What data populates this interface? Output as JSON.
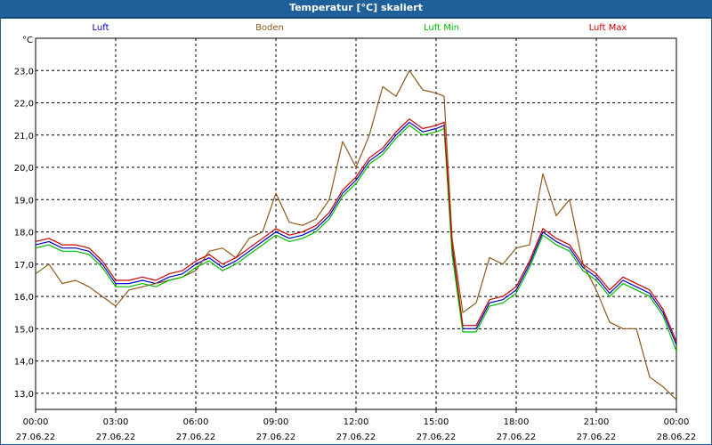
{
  "window": {
    "title": "Temperatur [°C] skaliert"
  },
  "chart_data": {
    "type": "line",
    "title": "Temperatur [°C] skaliert",
    "ylabel": "°C",
    "xlabel": "",
    "ylim": [
      12.5,
      24.0
    ],
    "xlim": [
      0,
      24
    ],
    "grid": true,
    "legend_placement": "top",
    "x_ticks": [
      {
        "t": 0,
        "time": "00:00",
        "date": "27.06.22"
      },
      {
        "t": 3,
        "time": "03:00",
        "date": "27.06.22"
      },
      {
        "t": 6,
        "time": "06:00",
        "date": "27.06.22"
      },
      {
        "t": 9,
        "time": "09:00",
        "date": "27.06.22"
      },
      {
        "t": 12,
        "time": "12:00",
        "date": "27.06.22"
      },
      {
        "t": 15,
        "time": "15:00",
        "date": "27.06.22"
      },
      {
        "t": 18,
        "time": "18:00",
        "date": "27.06.22"
      },
      {
        "t": 21,
        "time": "21:00",
        "date": "27.06.22"
      },
      {
        "t": 24,
        "time": "00:00",
        "date": "28.06.22"
      }
    ],
    "y_ticks": [
      {
        "v": 13.0,
        "label": "13,0"
      },
      {
        "v": 14.0,
        "label": "14,0"
      },
      {
        "v": 15.0,
        "label": "15,0"
      },
      {
        "v": 16.0,
        "label": "16,0"
      },
      {
        "v": 17.0,
        "label": "17,0"
      },
      {
        "v": 18.0,
        "label": "18,0"
      },
      {
        "v": 19.0,
        "label": "19,0"
      },
      {
        "v": 20.0,
        "label": "20,0"
      },
      {
        "v": 21.0,
        "label": "21,0"
      },
      {
        "v": 22.0,
        "label": "22,0"
      },
      {
        "v": 23.0,
        "label": "23,0"
      }
    ],
    "series": [
      {
        "name": "Luft",
        "color": "#0000c0",
        "points": [
          [
            0,
            17.6
          ],
          [
            0.5,
            17.7
          ],
          [
            1,
            17.5
          ],
          [
            1.5,
            17.5
          ],
          [
            2,
            17.4
          ],
          [
            2.5,
            17.0
          ],
          [
            3,
            16.4
          ],
          [
            3.5,
            16.4
          ],
          [
            4,
            16.5
          ],
          [
            4.5,
            16.4
          ],
          [
            5,
            16.6
          ],
          [
            5.5,
            16.7
          ],
          [
            6,
            17.0
          ],
          [
            6.5,
            17.2
          ],
          [
            7,
            16.9
          ],
          [
            7.5,
            17.1
          ],
          [
            8,
            17.4
          ],
          [
            8.5,
            17.7
          ],
          [
            9,
            18.0
          ],
          [
            9.5,
            17.8
          ],
          [
            10,
            17.9
          ],
          [
            10.5,
            18.1
          ],
          [
            11,
            18.5
          ],
          [
            11.5,
            19.2
          ],
          [
            12,
            19.6
          ],
          [
            12.5,
            20.2
          ],
          [
            13,
            20.5
          ],
          [
            13.5,
            21.0
          ],
          [
            14,
            21.4
          ],
          [
            14.5,
            21.1
          ],
          [
            15,
            21.2
          ],
          [
            15.3,
            21.3
          ],
          [
            15.6,
            17.5
          ],
          [
            16,
            15.0
          ],
          [
            16.5,
            15.0
          ],
          [
            17,
            15.8
          ],
          [
            17.5,
            15.9
          ],
          [
            18,
            16.2
          ],
          [
            18.5,
            17.0
          ],
          [
            19,
            18.0
          ],
          [
            19.5,
            17.7
          ],
          [
            20,
            17.5
          ],
          [
            20.5,
            16.9
          ],
          [
            21,
            16.6
          ],
          [
            21.5,
            16.1
          ],
          [
            22,
            16.5
          ],
          [
            22.5,
            16.3
          ],
          [
            23,
            16.1
          ],
          [
            23.5,
            15.5
          ],
          [
            24,
            14.5
          ]
        ]
      },
      {
        "name": "Boden",
        "color": "#8b5a1a",
        "points": [
          [
            0,
            16.7
          ],
          [
            0.5,
            17.0
          ],
          [
            1,
            16.4
          ],
          [
            1.5,
            16.5
          ],
          [
            2,
            16.3
          ],
          [
            2.5,
            16.0
          ],
          [
            3,
            15.7
          ],
          [
            3.5,
            16.2
          ],
          [
            4,
            16.3
          ],
          [
            4.5,
            16.4
          ],
          [
            5,
            16.5
          ],
          [
            5.5,
            16.6
          ],
          [
            6,
            16.8
          ],
          [
            6.5,
            17.4
          ],
          [
            7,
            17.5
          ],
          [
            7.5,
            17.2
          ],
          [
            8,
            17.8
          ],
          [
            8.5,
            18.0
          ],
          [
            9,
            19.2
          ],
          [
            9.5,
            18.3
          ],
          [
            10,
            18.2
          ],
          [
            10.5,
            18.4
          ],
          [
            11,
            19.0
          ],
          [
            11.5,
            20.8
          ],
          [
            12,
            20.0
          ],
          [
            12.5,
            21.0
          ],
          [
            13,
            22.5
          ],
          [
            13.5,
            22.2
          ],
          [
            14,
            23.0
          ],
          [
            14.5,
            22.4
          ],
          [
            15,
            22.3
          ],
          [
            15.3,
            22.2
          ],
          [
            15.6,
            17.8
          ],
          [
            16,
            15.5
          ],
          [
            16.5,
            15.8
          ],
          [
            17,
            17.2
          ],
          [
            17.5,
            17.0
          ],
          [
            18,
            17.5
          ],
          [
            18.5,
            17.6
          ],
          [
            19,
            19.8
          ],
          [
            19.5,
            18.5
          ],
          [
            20,
            19.0
          ],
          [
            20.5,
            17.0
          ],
          [
            21,
            16.2
          ],
          [
            21.5,
            15.2
          ],
          [
            22,
            15.0
          ],
          [
            22.5,
            15.0
          ],
          [
            23,
            13.5
          ],
          [
            23.5,
            13.2
          ],
          [
            24,
            12.8
          ]
        ]
      },
      {
        "name": "Luft Min",
        "color": "#00bb00",
        "points": [
          [
            0,
            17.5
          ],
          [
            0.5,
            17.6
          ],
          [
            1,
            17.4
          ],
          [
            1.5,
            17.4
          ],
          [
            2,
            17.3
          ],
          [
            2.5,
            16.9
          ],
          [
            3,
            16.3
          ],
          [
            3.5,
            16.3
          ],
          [
            4,
            16.4
          ],
          [
            4.5,
            16.3
          ],
          [
            5,
            16.5
          ],
          [
            5.5,
            16.6
          ],
          [
            6,
            16.9
          ],
          [
            6.5,
            17.1
          ],
          [
            7,
            16.8
          ],
          [
            7.5,
            17.0
          ],
          [
            8,
            17.3
          ],
          [
            8.5,
            17.6
          ],
          [
            9,
            17.9
          ],
          [
            9.5,
            17.7
          ],
          [
            10,
            17.8
          ],
          [
            10.5,
            18.0
          ],
          [
            11,
            18.4
          ],
          [
            11.5,
            19.1
          ],
          [
            12,
            19.5
          ],
          [
            12.5,
            20.1
          ],
          [
            13,
            20.4
          ],
          [
            13.5,
            20.9
          ],
          [
            14,
            21.3
          ],
          [
            14.5,
            21.0
          ],
          [
            15,
            21.1
          ],
          [
            15.3,
            21.2
          ],
          [
            15.6,
            17.3
          ],
          [
            16,
            14.9
          ],
          [
            16.5,
            14.9
          ],
          [
            17,
            15.7
          ],
          [
            17.5,
            15.8
          ],
          [
            18,
            16.1
          ],
          [
            18.5,
            16.9
          ],
          [
            19,
            17.9
          ],
          [
            19.5,
            17.6
          ],
          [
            20,
            17.4
          ],
          [
            20.5,
            16.8
          ],
          [
            21,
            16.5
          ],
          [
            21.5,
            16.0
          ],
          [
            22,
            16.4
          ],
          [
            22.5,
            16.2
          ],
          [
            23,
            16.0
          ],
          [
            23.5,
            15.4
          ],
          [
            24,
            14.3
          ]
        ]
      },
      {
        "name": "Luft Max",
        "color": "#cc0000",
        "points": [
          [
            0,
            17.7
          ],
          [
            0.5,
            17.8
          ],
          [
            1,
            17.6
          ],
          [
            1.5,
            17.6
          ],
          [
            2,
            17.5
          ],
          [
            2.5,
            17.1
          ],
          [
            3,
            16.5
          ],
          [
            3.5,
            16.5
          ],
          [
            4,
            16.6
          ],
          [
            4.5,
            16.5
          ],
          [
            5,
            16.7
          ],
          [
            5.5,
            16.8
          ],
          [
            6,
            17.1
          ],
          [
            6.5,
            17.3
          ],
          [
            7,
            17.0
          ],
          [
            7.5,
            17.2
          ],
          [
            8,
            17.5
          ],
          [
            8.5,
            17.8
          ],
          [
            9,
            18.1
          ],
          [
            9.5,
            17.9
          ],
          [
            10,
            18.0
          ],
          [
            10.5,
            18.2
          ],
          [
            11,
            18.6
          ],
          [
            11.5,
            19.3
          ],
          [
            12,
            19.7
          ],
          [
            12.5,
            20.3
          ],
          [
            13,
            20.6
          ],
          [
            13.5,
            21.1
          ],
          [
            14,
            21.5
          ],
          [
            14.5,
            21.2
          ],
          [
            15,
            21.3
          ],
          [
            15.3,
            21.4
          ],
          [
            15.6,
            17.6
          ],
          [
            16,
            15.1
          ],
          [
            16.5,
            15.1
          ],
          [
            17,
            15.9
          ],
          [
            17.5,
            16.0
          ],
          [
            18,
            16.3
          ],
          [
            18.5,
            17.1
          ],
          [
            19,
            18.1
          ],
          [
            19.5,
            17.8
          ],
          [
            20,
            17.6
          ],
          [
            20.5,
            17.0
          ],
          [
            21,
            16.7
          ],
          [
            21.5,
            16.2
          ],
          [
            22,
            16.6
          ],
          [
            22.5,
            16.4
          ],
          [
            23,
            16.2
          ],
          [
            23.5,
            15.6
          ],
          [
            24,
            14.6
          ]
        ]
      }
    ]
  }
}
